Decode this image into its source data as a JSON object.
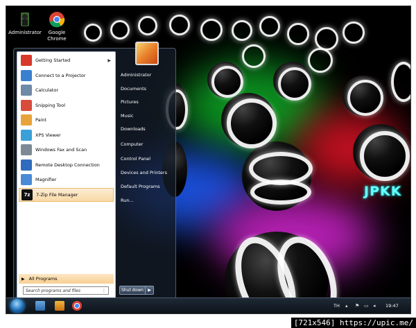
{
  "desktop": {
    "icons": [
      {
        "label": "Administrator",
        "icon": "user-folder-icon"
      },
      {
        "label": "Google Chrome",
        "icon": "chrome-icon"
      }
    ],
    "watermark": "JPKK"
  },
  "start_menu": {
    "programs": [
      {
        "label": "Getting Started",
        "icon": "getting-started-icon",
        "color": "#d8392b",
        "submenu": true
      },
      {
        "label": "Connect to a Projector",
        "icon": "projector-icon",
        "color": "#3b7fd0"
      },
      {
        "label": "Calculator",
        "icon": "calculator-icon",
        "color": "#6f8aa7"
      },
      {
        "label": "Snipping Tool",
        "icon": "scissors-icon",
        "color": "#d94c3c"
      },
      {
        "label": "Paint",
        "icon": "paint-icon",
        "color": "#e9a33b"
      },
      {
        "label": "XPS Viewer",
        "icon": "xps-viewer-icon",
        "color": "#3aa0d8"
      },
      {
        "label": "Windows Fax and Scan",
        "icon": "fax-icon",
        "color": "#7d8a96"
      },
      {
        "label": "Remote Desktop Connection",
        "icon": "remote-desktop-icon",
        "color": "#2f6cc0"
      },
      {
        "label": "Magnifier",
        "icon": "magnifier-icon",
        "color": "#4a8ad6"
      },
      {
        "label": "7-Zip File Manager",
        "icon": "7zip-icon",
        "color": "#111111",
        "highlighted": true
      }
    ],
    "all_programs": "All Programs",
    "search_placeholder": "Search programs and files",
    "right_items": [
      "Administrator",
      "Documents",
      "Pictures",
      "Music",
      "Downloads",
      "Computer",
      "Control Panel",
      "Devices and Printers",
      "Default Programs",
      "Run..."
    ],
    "shutdown_label": "Shut down"
  },
  "taskbar": {
    "language": "TH",
    "time": "19:47"
  },
  "stamp": "[721x546] https://upic.me/"
}
